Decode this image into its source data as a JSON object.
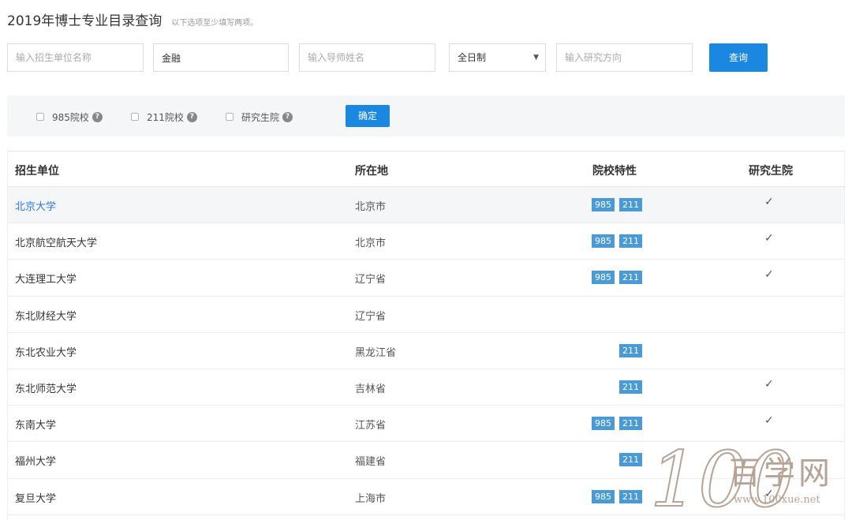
{
  "header": {
    "title": "2019年博士专业目录查询",
    "hint": "以下选项至少填写两项。"
  },
  "search": {
    "unit_placeholder": "输入招生单位名称",
    "unit_value": "",
    "major_value": "金融",
    "advisor_placeholder": "输入导师姓名",
    "advisor_value": "",
    "mode_selected": "全日制",
    "direction_placeholder": "输入研究方向",
    "direction_value": "",
    "query_label": "查询"
  },
  "filters": {
    "items": [
      {
        "label": "985院校",
        "checked": false
      },
      {
        "label": "211院校",
        "checked": false
      },
      {
        "label": "研究生院",
        "checked": false
      }
    ],
    "help_icon": "?",
    "confirm_label": "确定"
  },
  "table": {
    "headers": [
      "招生单位",
      "所在地",
      "院校特性",
      "研究生院"
    ],
    "check_mark": "✓",
    "rows": [
      {
        "name": "北京大学",
        "location": "北京市",
        "tag985": "985",
        "tag211": "211",
        "grad_school": true
      },
      {
        "name": "北京航空航天大学",
        "location": "北京市",
        "tag985": "985",
        "tag211": "211",
        "grad_school": true
      },
      {
        "name": "大连理工大学",
        "location": "辽宁省",
        "tag985": "985",
        "tag211": "211",
        "grad_school": true
      },
      {
        "name": "东北财经大学",
        "location": "辽宁省",
        "tag985": "",
        "tag211": "",
        "grad_school": false
      },
      {
        "name": "东北农业大学",
        "location": "黑龙江省",
        "tag985": "",
        "tag211": "211",
        "grad_school": false
      },
      {
        "name": "东北师范大学",
        "location": "吉林省",
        "tag985": "",
        "tag211": "211",
        "grad_school": true
      },
      {
        "name": "东南大学",
        "location": "江苏省",
        "tag985": "985",
        "tag211": "211",
        "grad_school": true
      },
      {
        "name": "福州大学",
        "location": "福建省",
        "tag985": "",
        "tag211": "211",
        "grad_school": false
      },
      {
        "name": "复旦大学",
        "location": "上海市",
        "tag985": "985",
        "tag211": "211",
        "grad_school": true
      }
    ]
  },
  "watermark": {
    "number": "100",
    "text": "百学网",
    "url": "www.100xue.net"
  },
  "colors": {
    "primary": "#1a88e0",
    "tag": "#4a9ad8",
    "link": "#2a7ae2",
    "watermark": "#b5a496"
  }
}
